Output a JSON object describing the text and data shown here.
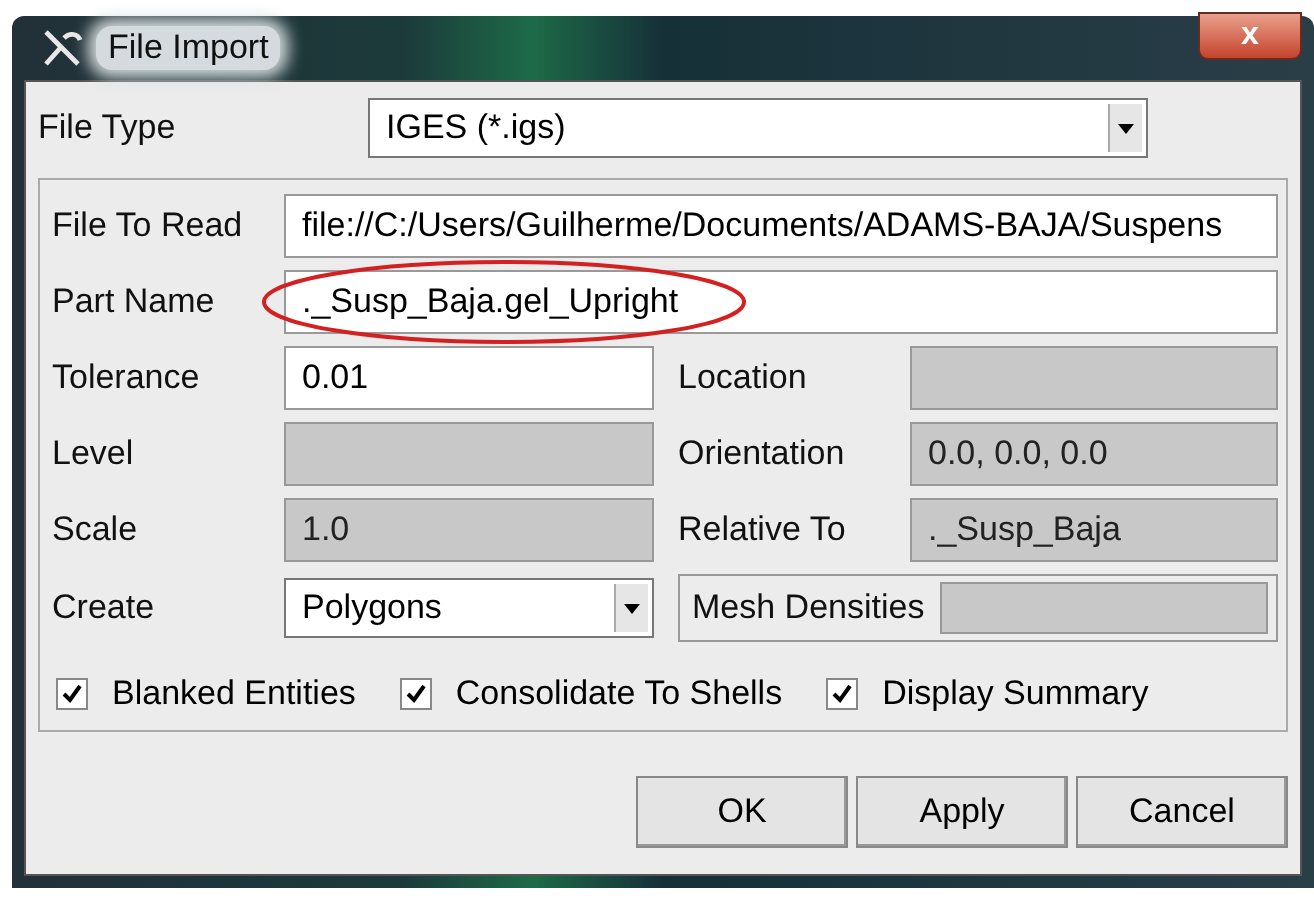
{
  "window": {
    "title": "File Import",
    "close": "x"
  },
  "file_type": {
    "label": "File Type",
    "value": "IGES (*.igs)"
  },
  "fields": [
    {
      "kind": "wide",
      "label": "File To Read",
      "value": "file://C:/Users/Guilherme/Documents/ADAMS-BAJA/Suspens",
      "disabled": false
    },
    {
      "kind": "wide",
      "label": "Part Name",
      "value": "._Susp_Baja.gel_Upright",
      "disabled": false,
      "highlighted": true
    },
    {
      "kind": "text",
      "label": "Tolerance",
      "value": "0.01",
      "disabled": false
    },
    {
      "kind": "text",
      "label": "Location",
      "disabled": true
    },
    {
      "kind": "text",
      "label": "Level",
      "disabled": true
    },
    {
      "kind": "text",
      "label": "Orientation",
      "value": "0.0, 0.0, 0.0",
      "disabled": true
    },
    {
      "kind": "text",
      "label": "Scale",
      "value": "1.0",
      "disabled": true
    },
    {
      "kind": "text",
      "label": "Relative To",
      "value": "._Susp_Baja",
      "disabled": true
    },
    {
      "kind": "dropdown",
      "label": "Create",
      "value": "Polygons",
      "disabled": false
    },
    {
      "kind": "boxed",
      "label": "Mesh Densities",
      "disabled": true
    }
  ],
  "checkboxes": [
    {
      "label": "Blanked Entities",
      "checked": true
    },
    {
      "label": "Consolidate To Shells",
      "checked": true
    },
    {
      "label": "Display Summary",
      "checked": true
    }
  ],
  "buttons": [
    "OK",
    "Apply",
    "Cancel"
  ]
}
